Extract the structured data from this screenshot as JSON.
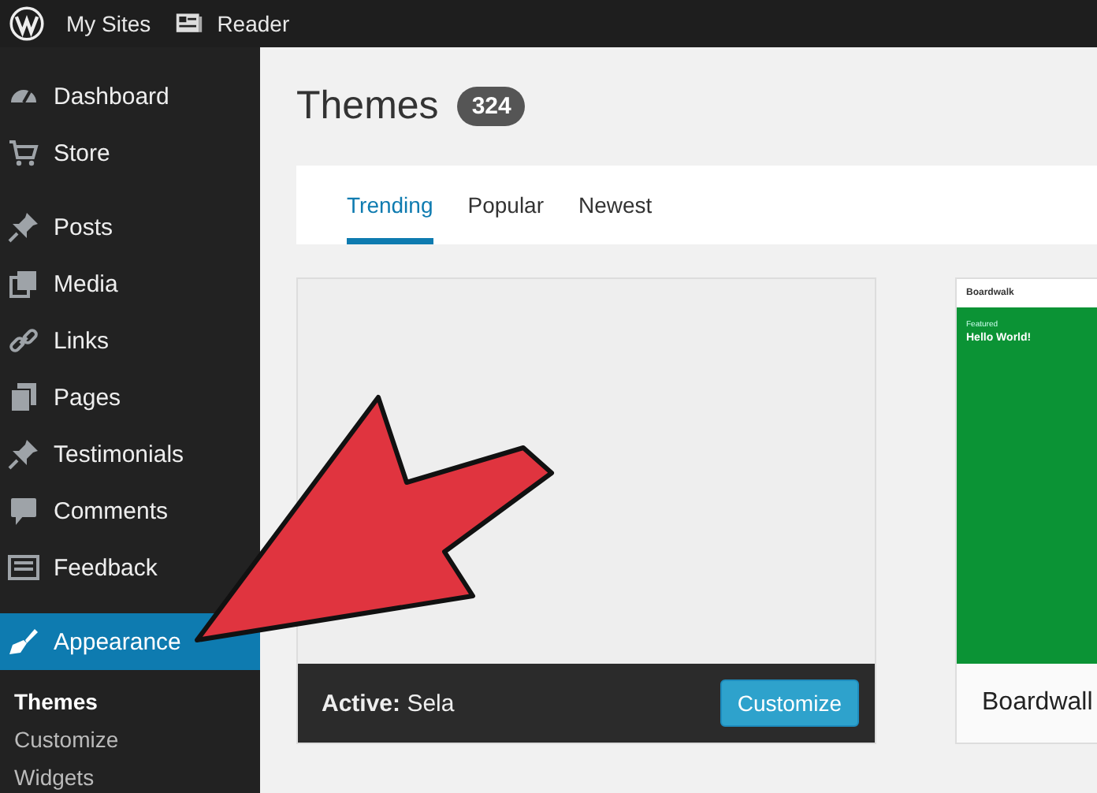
{
  "top_bar": {
    "items": [
      {
        "label": "My Sites"
      },
      {
        "label": "Reader"
      }
    ]
  },
  "sidebar": {
    "groups": [
      [
        {
          "label": "Dashboard",
          "selected": false
        },
        {
          "label": "Store",
          "selected": false
        }
      ],
      [
        {
          "label": "Posts",
          "selected": false
        },
        {
          "label": "Media",
          "selected": false
        },
        {
          "label": "Links",
          "selected": false
        },
        {
          "label": "Pages",
          "selected": false
        },
        {
          "label": "Testimonials",
          "selected": false
        },
        {
          "label": "Comments",
          "selected": false
        },
        {
          "label": "Feedback",
          "selected": false
        }
      ],
      [
        {
          "label": "Appearance",
          "selected": true,
          "children": [
            {
              "label": "Themes",
              "selected": true
            },
            {
              "label": "Customize",
              "selected": false
            },
            {
              "label": "Widgets",
              "selected": false
            }
          ]
        }
      ]
    ]
  },
  "page": {
    "title": "Themes",
    "count": "324"
  },
  "tabs": [
    {
      "label": "Trending",
      "selected": true
    },
    {
      "label": "Popular",
      "selected": false
    },
    {
      "label": "Newest",
      "selected": false
    }
  ],
  "themes": [
    {
      "kind": "active",
      "active_label": "Active:",
      "name": "Sela",
      "button": "Customize"
    },
    {
      "kind": "preview",
      "name": "Boardwall",
      "preview": {
        "site_title": "Boardwalk",
        "tag": "Featured",
        "headline": "Hello World!"
      }
    }
  ]
}
